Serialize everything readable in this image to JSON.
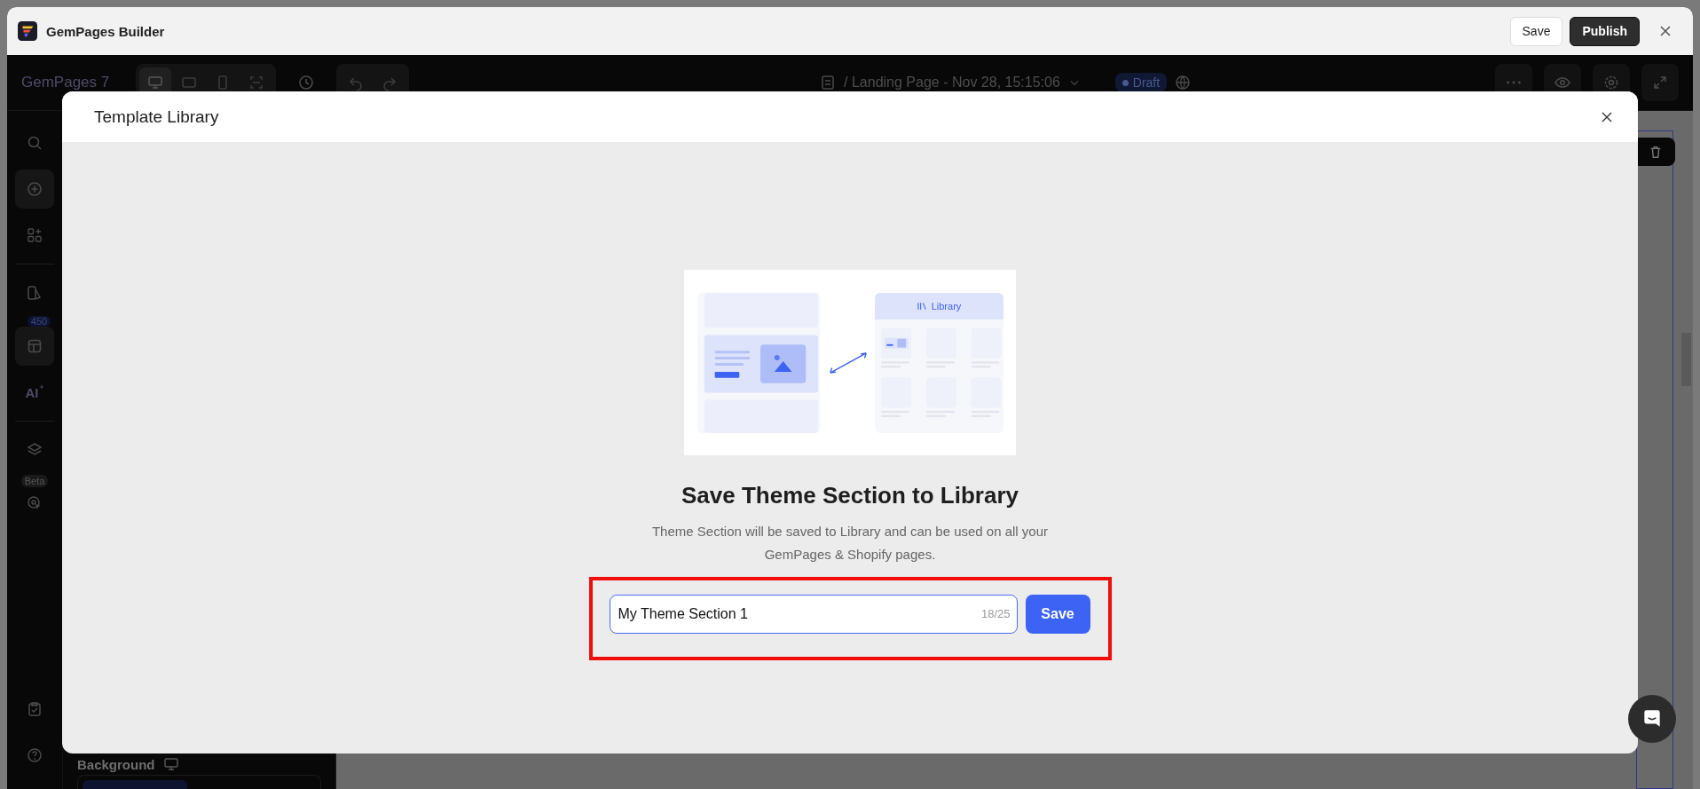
{
  "window": {
    "title": "GemPages Builder",
    "buttons": [
      {
        "label": "Save",
        "kind": "secondary"
      },
      {
        "label": "Publish",
        "kind": "primary"
      }
    ]
  },
  "toolbar": {
    "brand": "GemPages 7",
    "devices": [
      {
        "kind": "desktop",
        "selected": true
      },
      {
        "kind": "tablet",
        "selected": false
      },
      {
        "kind": "mobile",
        "selected": false
      },
      {
        "kind": "fit",
        "selected": false
      }
    ],
    "page_title": "/ Landing Page - Nov 28, 15:15:06",
    "status": "Draft"
  },
  "sidebar": {
    "items": [
      {
        "kind": "search",
        "selected": false
      },
      {
        "kind": "add",
        "selected": true
      },
      {
        "kind": "apps",
        "selected": false
      },
      {
        "kind": "pages",
        "selected": false
      },
      {
        "kind": "templates",
        "selected": true,
        "badge": "450"
      },
      {
        "kind": "ai",
        "selected": false,
        "label": "AI"
      },
      {
        "kind": "layers",
        "selected": false
      },
      {
        "kind": "target",
        "selected": false,
        "badge": "Beta"
      }
    ],
    "bottom_items": [
      {
        "kind": "checklist"
      },
      {
        "kind": "help"
      }
    ]
  },
  "panel": {
    "heading": "Background"
  },
  "modal": {
    "title": "Template Library",
    "illustration": {
      "label": "Library"
    },
    "heading": "Save Theme Section to Library",
    "description": "Theme Section will be saved to Library and can be used on all your GemPages & Shopify pages.",
    "name_field": {
      "value": "My Theme Section 1",
      "counter": "18/25",
      "focused": true
    },
    "save_button": "Save",
    "highlighted": true
  }
}
